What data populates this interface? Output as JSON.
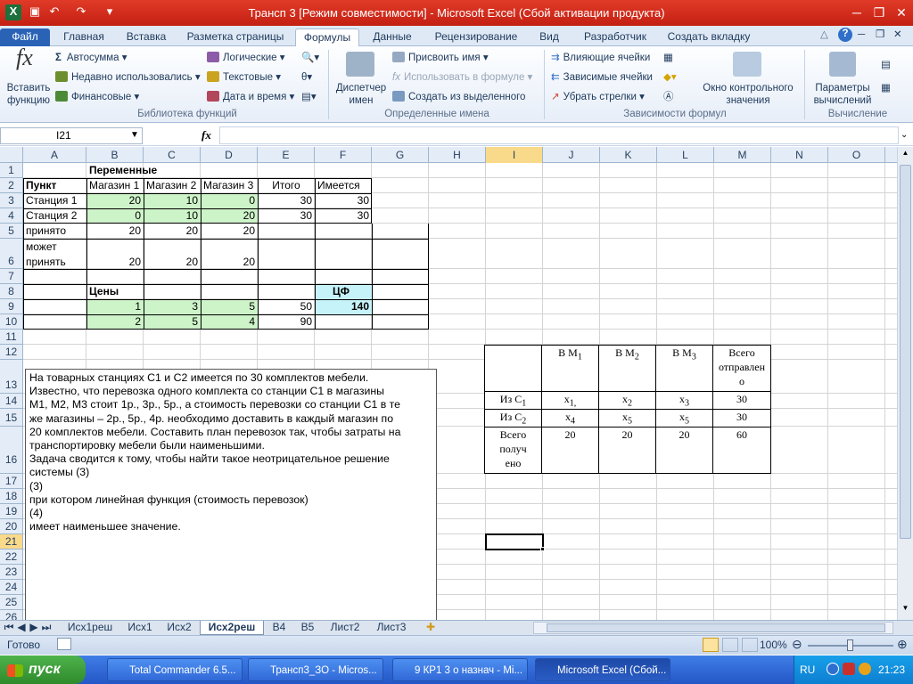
{
  "window": {
    "title": "Трансп 3  [Режим совместимости]  -  Microsoft Excel (Сбой активации продукта)"
  },
  "ribbon_tabs": [
    "Файл",
    "Главная",
    "Вставка",
    "Разметка страницы",
    "Формулы",
    "Данные",
    "Рецензирование",
    "Вид",
    "Разработчик",
    "Создать вкладку"
  ],
  "ribbon": {
    "insert_function": "Вставить функцию",
    "autosum": "Автосумма",
    "recent": "Недавно использовались",
    "financial": "Финансовые",
    "logical": "Логические",
    "text": "Текстовые",
    "datetime": "Дата и время",
    "group_library": "Библиотека функций",
    "name_manager": "Диспетчер имен",
    "assign_name": "Присвоить имя",
    "use_in_formula": "Использовать в формуле",
    "create_from_sel": "Создать из выделенного",
    "group_names": "Определенные имена",
    "trace_precedents": "Влияющие ячейки",
    "trace_dependents": "Зависимые ячейки",
    "remove_arrows": "Убрать стрелки",
    "group_audit": "Зависимости формул",
    "watch_window": "Окно контрольного значения",
    "calc_options": "Параметры вычислений",
    "group_calc": "Вычисление"
  },
  "formula_bar": {
    "name_box": "I21",
    "fx": "fx",
    "formula": ""
  },
  "columns": [
    "A",
    "B",
    "C",
    "D",
    "E",
    "F",
    "G",
    "H",
    "I",
    "J",
    "K",
    "L",
    "M",
    "N",
    "O"
  ],
  "rows": [
    "1",
    "2",
    "3",
    "4",
    "5",
    "6",
    "7",
    "8",
    "9",
    "10",
    "11",
    "12",
    "13",
    "14",
    "15",
    "16",
    "17",
    "18",
    "19",
    "20",
    "21",
    "22",
    "23",
    "24",
    "25",
    "26"
  ],
  "cells": {
    "b1": "Переменные",
    "a2": "Пункт",
    "b2": "Магазин 1",
    "c2": "Магазин 2",
    "d2": "Магазин 3",
    "e2": "Итого",
    "f2": "Имеется",
    "a3": "Станция 1",
    "b3": "20",
    "c3": "10",
    "d3": "0",
    "e3": "30",
    "f3": "30",
    "a4": "Станция 2",
    "b4": "0",
    "c4": "10",
    "d4": "20",
    "e4": "30",
    "f4": "30",
    "a5": "принято",
    "b5": "20",
    "c5": "20",
    "d5": "20",
    "a6a": "может",
    "a6b": "принять",
    "b6": "20",
    "c6": "20",
    "d6": "20",
    "b8": "Цены",
    "f8": "ЦФ",
    "b9": "1",
    "c9": "3",
    "d9": "5",
    "e9": "50",
    "f9": "140",
    "b10": "2",
    "c10": "5",
    "d10": "4",
    "e10": "90"
  },
  "textbox": {
    "lines": [
      "На товарных станциях  С1 и С2 имеется  по 30 комплектов мебели.",
      "Известно, что перевозка одного комплекта со станции  С1 в магазины",
      "М1, М2, М3 стоит 1р., 3р., 5р., а стоимость перевозки со станции  С1 в те",
      "же магазины  – 2р., 5р., 4р. необходимо доставить в каждый магазин  по",
      "20 комплектов мебели. Составить план перевозок так, чтобы затраты на",
      "транспортировку мебели были наименьшими.",
      "Задача сводится к тому, чтобы найти такое неотрицательное  решение",
      "системы  (3)",
      "   (3)",
      "при котором линейная функция  (стоимость перевозок)",
      "   (4)",
      "имеет наименьшее  значение."
    ]
  },
  "embedded_table": {
    "h1": "В М",
    "h1s": "1",
    "h2": "В М",
    "h2s": "2",
    "h3": "В М",
    "h3s": "3",
    "h4a": "Всего",
    "h4b": "отправлен",
    "h4c": "о",
    "r1": "Из С",
    "r1s": "1",
    "r1a": "x",
    "r1as": "1,",
    "r1b": "x",
    "r1bs": "2",
    "r1c": "x",
    "r1cs": "3",
    "r1d": "30",
    "r2": "Из С",
    "r2s": "2",
    "r2a": "x",
    "r2as": "4",
    "r2b": "x",
    "r2bs": "5",
    "r2c": "x",
    "r2cs": "5",
    "r2d": "30",
    "r3a": "Всего",
    "r3b": "получ",
    "r3c": "ено",
    "r3v1": "20",
    "r3v2": "20",
    "r3v3": "20",
    "r3v4": "60"
  },
  "sheet_tabs": [
    "Исх1реш",
    "Исх1",
    "Исх2",
    "Исх2реш",
    "В4",
    "В5",
    "Лист2",
    "Лист3"
  ],
  "active_sheet": "Исх2реш",
  "status": {
    "ready": "Готово",
    "zoom": "100%"
  },
  "taskbar": {
    "start": "пуск",
    "tasks": [
      "Total Commander 6.5...",
      "Трансп3_ЗО - Micros...",
      "9 КР1 3 о назнач - Mi...",
      "Microsoft Excel (Сбой..."
    ],
    "lang": "RU",
    "time": "21:23"
  },
  "colors": {
    "title_red": "#d22d1d",
    "input_green": "#cdf3c8",
    "target_cyan": "#c6f2f9",
    "selection_header": "#f9d98a",
    "taskbar_blue": "#2f63d4"
  }
}
